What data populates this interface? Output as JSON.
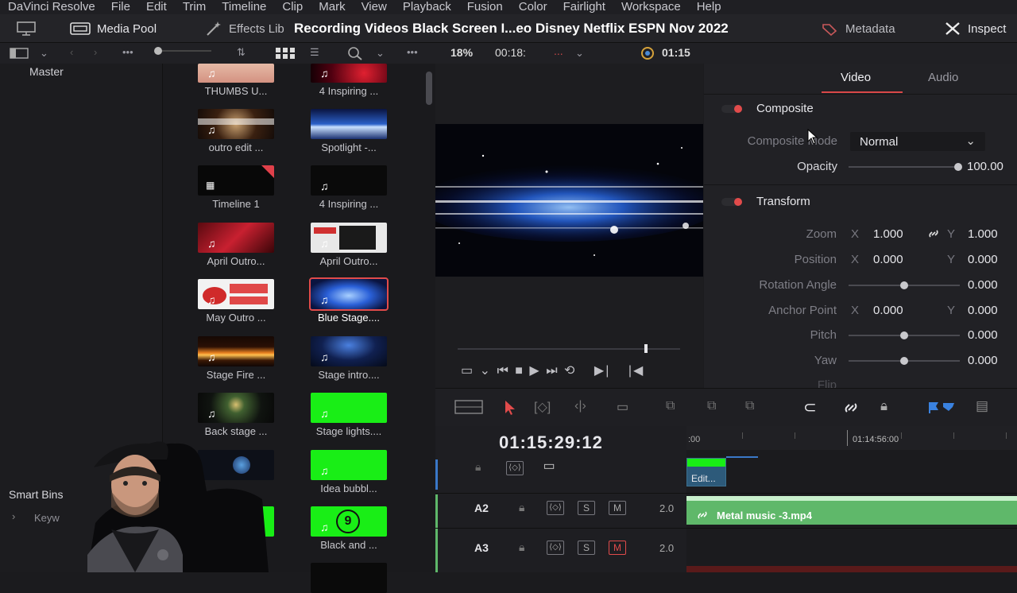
{
  "menu": [
    "DaVinci Resolve",
    "File",
    "Edit",
    "Trim",
    "Timeline",
    "Clip",
    "Mark",
    "View",
    "Playback",
    "Fusion",
    "Color",
    "Fairlight",
    "Workspace",
    "Help"
  ],
  "toolbar": {
    "media_pool": "Media Pool",
    "effects": "Effects Lib",
    "window_title": "Recording Videos Black Screen I...eo Disney Netflix ESPN Nov 2022",
    "metadata": "Metadata",
    "inspector": "Inspect"
  },
  "viewer": {
    "zoom": "18%",
    "timecode_short": "00:18:",
    "dots": "...",
    "timecode_right": "01:15"
  },
  "bins": {
    "master": "Master",
    "smart_bins": "Smart Bins",
    "keywords": "Keyw"
  },
  "clips_left": [
    "THUMBS U...",
    "outro edit ...",
    "Timeline 1",
    "April Outro...",
    "May Outro ...",
    "Stage Fire ...",
    "Back stage ...",
    ""
  ],
  "clips_right": [
    "4 Inspiring ...",
    "Spotlight -...",
    "4 Inspiring ...",
    "April Outro...",
    "Blue Stage....",
    "Stage intro....",
    "Stage lights....",
    "Idea bubbl...",
    "Black and ..."
  ],
  "badge_number": "9",
  "inspector": {
    "tabs": [
      "Video",
      "Audio"
    ],
    "composite": "Composite",
    "composite_mode_label": "Composite Mode",
    "composite_mode_value": "Normal",
    "opacity_label": "Opacity",
    "opacity_value": "100.00",
    "transform": "Transform",
    "zoom_label": "Zoom",
    "zoom_x": "1.000",
    "zoom_y": "1.000",
    "position_label": "Position",
    "position_x": "0.000",
    "position_y": "0.000",
    "rotation_label": "Rotation Angle",
    "rotation_value": "0.000",
    "anchor_label": "Anchor Point",
    "anchor_x": "0.000",
    "anchor_y": "0.000",
    "pitch_label": "Pitch",
    "pitch_value": "0.000",
    "yaw_label": "Yaw",
    "yaw_value": "0.000",
    "flip_label": "Flip",
    "x": "X",
    "y": "Y"
  },
  "timeline": {
    "timecode": "01:15:29:12",
    "ruler_left": ":00",
    "ruler_mark": "01:14:56:00",
    "video_clip": "Edit...",
    "audio_clip": "Metal music -3.mp4",
    "tracks": [
      {
        "name": "A2",
        "s": "S",
        "m": "M",
        "level": "2.0"
      },
      {
        "name": "A3",
        "s": "S",
        "m": "M",
        "level": "2.0"
      }
    ]
  },
  "colors": {
    "accent_red": "#e14b4b",
    "audio_green": "#5fb86a",
    "green_screen": "#19ee16"
  }
}
